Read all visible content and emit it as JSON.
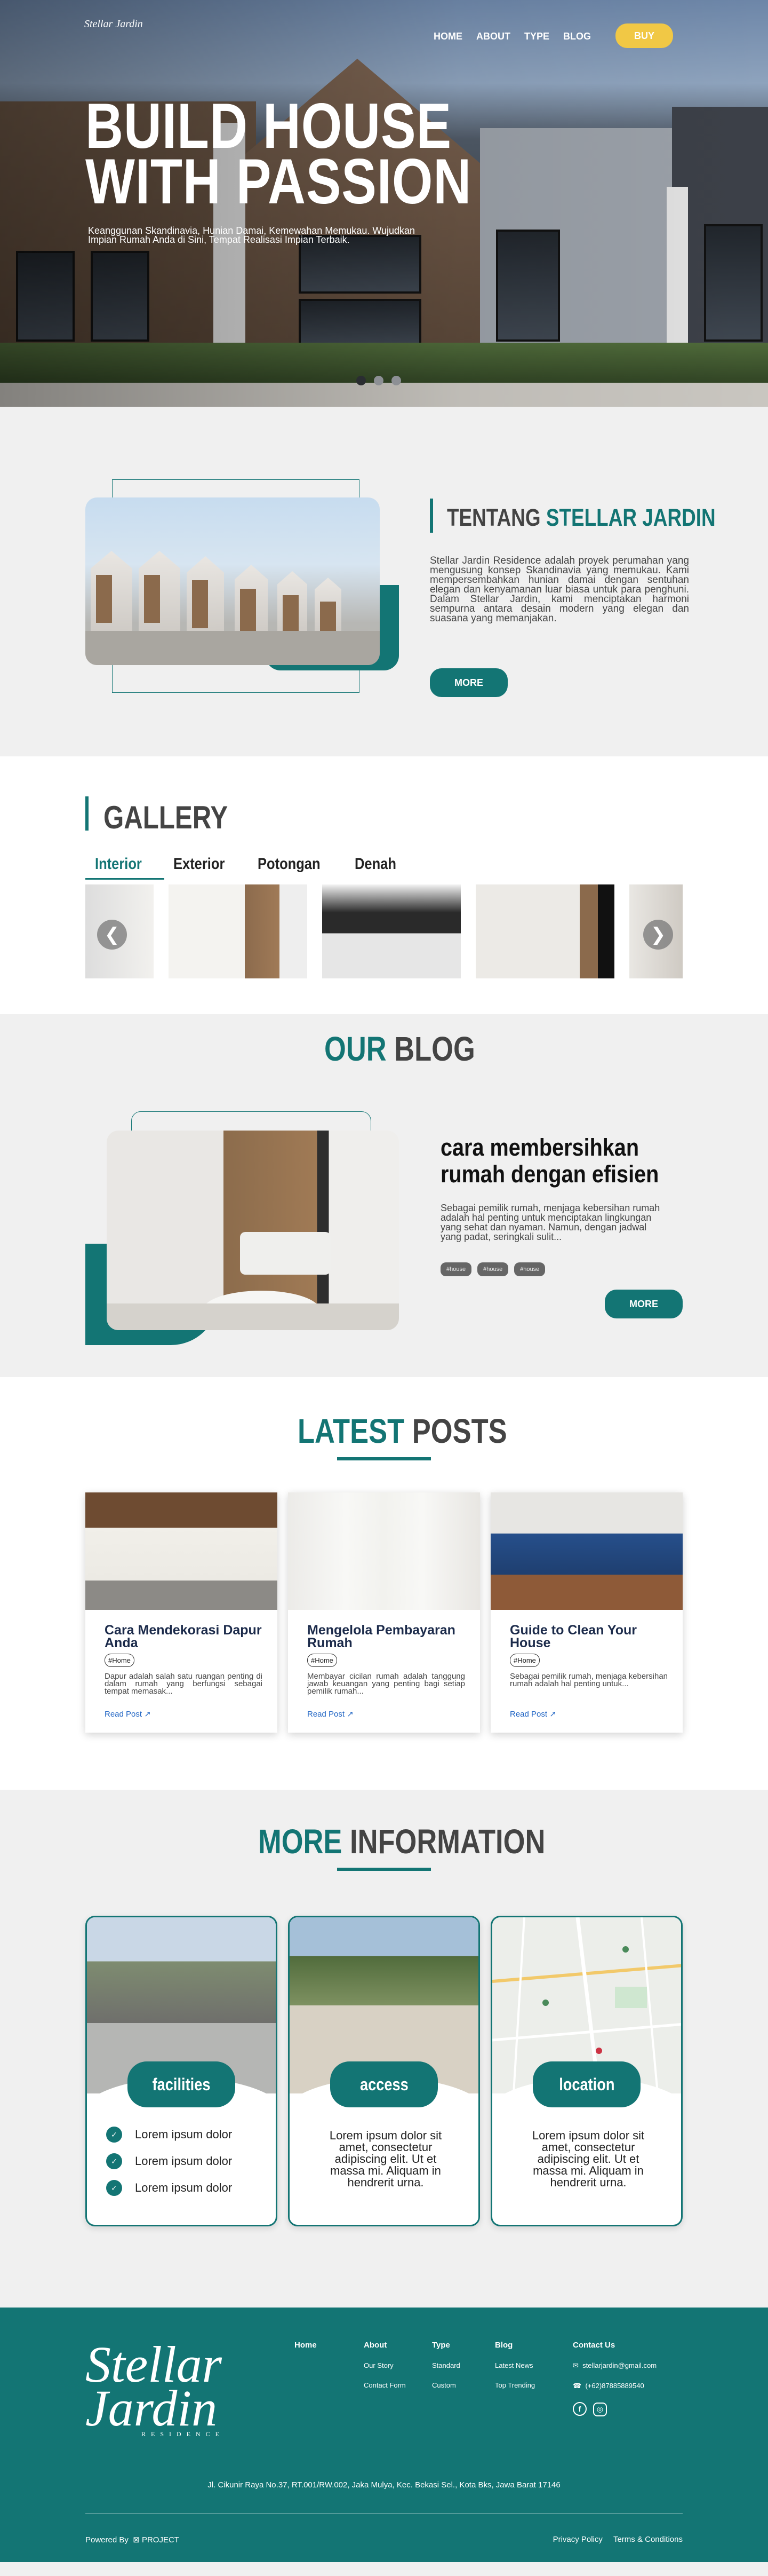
{
  "brand": {
    "logo": "Stellar Jardin",
    "logo_sub": "RESIDENCE"
  },
  "nav": {
    "items": [
      "HOME",
      "ABOUT",
      "TYPE",
      "BLOG"
    ],
    "buy": "BUY"
  },
  "hero": {
    "title_line1": "BUILD HOUSE",
    "title_line2": "WITH PASSION",
    "subtitle": "Keanggunan Skandinavia, Hunian Damai, Kemewahan Memukau. Wujudkan Impian Rumah Anda di Sini, Tempat Realisasi Impian Terbaik."
  },
  "about": {
    "title_a": "TENTANG",
    "title_b": "STELLAR JARDIN",
    "text": "Stellar Jardin Residence adalah proyek perumahan yang mengusung konsep Skandinavia yang memukau. Kami mempersembahkan hunian damai dengan sentuhan elegan dan kenyamanan luar biasa untuk para penghuni. Dalam Stellar Jardin, kami menciptakan harmoni sempurna antara desain modern yang elegan dan suasana yang memanjakan.",
    "button": "MORE"
  },
  "gallery": {
    "title": "GALLERY",
    "tabs": [
      "Interior",
      "Exterior",
      "Potongan",
      "Denah"
    ],
    "prev": "❮",
    "next": "❯"
  },
  "blog": {
    "title_a": "OUR",
    "title_b": "BLOG",
    "headline": "cara membersihkan rumah dengan efisien",
    "excerpt": "Sebagai pemilik rumah, menjaga kebersihan rumah adalah hal penting untuk menciptakan lingkungan yang sehat dan nyaman. Namun, dengan jadwal yang padat, seringkali sulit...",
    "tags": [
      "#house",
      "#house",
      "#house"
    ],
    "button": "MORE"
  },
  "latest": {
    "title_a": "LATEST",
    "title_b": "POSTS",
    "posts": [
      {
        "title": "Cara Mendekorasi Dapur Anda",
        "tag": "#Home",
        "text": "Dapur adalah salah satu ruangan penting di dalam rumah yang berfungsi sebagai tempat memasak...",
        "link": "Read Post ↗"
      },
      {
        "title": "Mengelola Pembayaran Rumah",
        "tag": "#Home",
        "text": "Membayar cicilan rumah adalah tanggung jawab keuangan yang penting bagi setiap pemilik rumah...",
        "link": "Read Post ↗"
      },
      {
        "title": "Guide to Clean Your House",
        "tag": "#Home",
        "text": "Sebagai pemilik rumah, menjaga kebersihan rumah adalah hal penting untuk...",
        "link": "Read Post ↗"
      }
    ]
  },
  "info": {
    "title_a": "MORE",
    "title_b": "INFORMATION",
    "cards": [
      {
        "label": "facilities",
        "items": [
          "Lorem ipsum dolor",
          "Lorem ipsum dolor",
          "Lorem ipsum dolor"
        ]
      },
      {
        "label": "access",
        "text": "Lorem ipsum dolor sit amet, consectetur adipiscing elit. Ut et massa mi. Aliquam in hendrerit urna."
      },
      {
        "label": "location",
        "text": "Lorem ipsum dolor sit amet, consectetur adipiscing elit. Ut et massa mi. Aliquam in hendrerit urna."
      }
    ]
  },
  "footer": {
    "cols": [
      {
        "head": "Home",
        "items": []
      },
      {
        "head": "About",
        "items": [
          "Our Story",
          "Contact Form"
        ]
      },
      {
        "head": "Type",
        "items": [
          "Standard",
          "Custom"
        ]
      },
      {
        "head": "Blog",
        "items": [
          "Latest News",
          "Top Trending"
        ]
      }
    ],
    "contact_head": "Contact Us",
    "email": "stellarjardin@gmail.com",
    "phone": "(+62)87885889540",
    "address": "Jl. Cikunir Raya No.37, RT.001/RW.002, Jaka Mulya, Kec. Bekasi Sel., Kota Bks, Jawa Barat 17146",
    "powered": "Powered By",
    "powered_brand": "PROJECT",
    "privacy": "Privacy Policy",
    "terms": "Terms & Conditions"
  },
  "colors": {
    "primary": "#137574",
    "accent": "#f1c845",
    "background": "#f0f0f0"
  }
}
